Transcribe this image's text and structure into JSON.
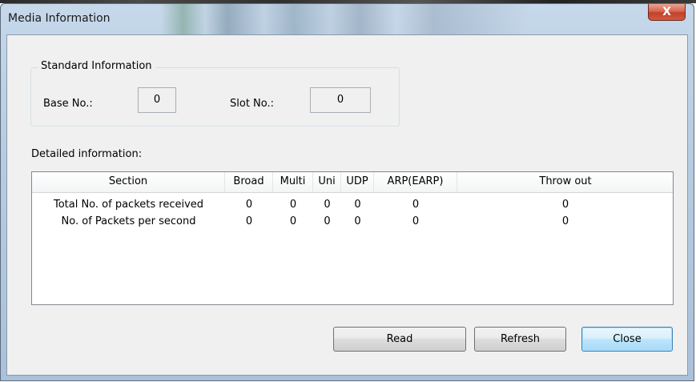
{
  "window": {
    "title": "Media Information",
    "close_glyph": "X"
  },
  "standard": {
    "legend": "Standard Information",
    "base_label": "Base No.:",
    "base_value": "0",
    "slot_label": "Slot No.:",
    "slot_value": "0"
  },
  "detailed": {
    "label": "Detailed information:",
    "columns": [
      "Section",
      "Broad",
      "Multi",
      "Uni",
      "UDP",
      "ARP(EARP)",
      "Throw out"
    ],
    "rows": [
      [
        "Total No. of packets received",
        "0",
        "0",
        "0",
        "0",
        "0",
        "0"
      ],
      [
        "No. of Packets per second",
        "0",
        "0",
        "0",
        "0",
        "0",
        "0"
      ]
    ]
  },
  "buttons": {
    "read": "Read",
    "refresh": "Refresh",
    "close": "Close"
  }
}
